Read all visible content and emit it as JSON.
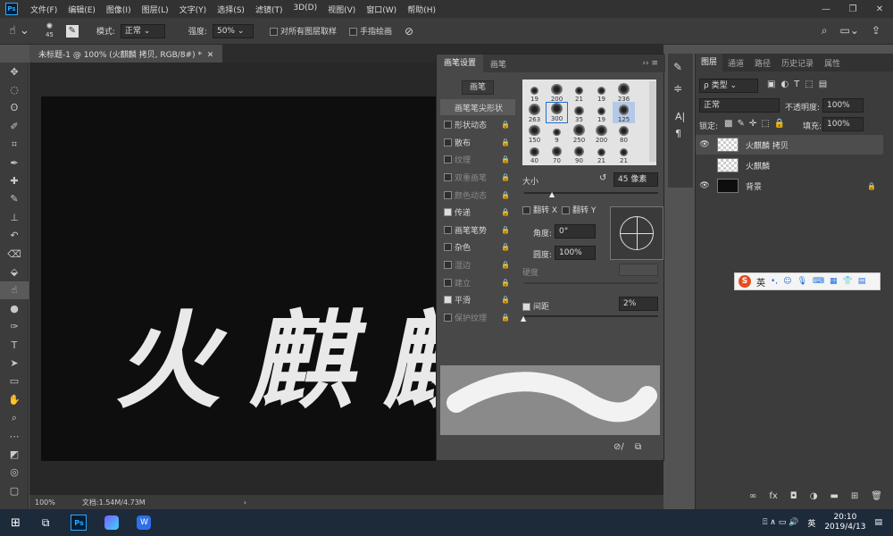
{
  "app": {
    "logo": "Ps",
    "window_controls": [
      "—",
      "❐",
      "✕"
    ]
  },
  "menu": [
    "文件(F)",
    "编辑(E)",
    "图像(I)",
    "图层(L)",
    "文字(Y)",
    "选择(S)",
    "滤镜(T)",
    "3D(D)",
    "视图(V)",
    "窗口(W)",
    "帮助(H)"
  ],
  "options": {
    "brush_size": "45",
    "mode_label": "模式:",
    "mode_value": "正常",
    "strength_label": "强度:",
    "strength_value": "50%",
    "sample_all_label": "对所有图层取样",
    "finger_paint_label": "手指绘画"
  },
  "document": {
    "tab": "未标题-1 @ 100% (火麒麟 拷贝, RGB/8#) *",
    "zoom": "100%",
    "doc_info": "文档:1.54M/4.73M",
    "canvas_text": "火麒麟"
  },
  "brush_panel": {
    "tabs": [
      "画笔设置",
      "画笔"
    ],
    "brushes_button": "画笔",
    "options": [
      {
        "label": "画笔笔尖形状",
        "checked": null,
        "dim": false,
        "lock": false
      },
      {
        "label": "形状动态",
        "checked": false,
        "dim": false,
        "lock": true
      },
      {
        "label": "散布",
        "checked": false,
        "dim": false,
        "lock": true
      },
      {
        "label": "纹理",
        "checked": false,
        "dim": true,
        "lock": true
      },
      {
        "label": "双重画笔",
        "checked": false,
        "dim": true,
        "lock": true
      },
      {
        "label": "颜色动态",
        "checked": false,
        "dim": true,
        "lock": true
      },
      {
        "label": "传递",
        "checked": true,
        "dim": false,
        "lock": true
      },
      {
        "label": "画笔笔势",
        "checked": false,
        "dim": false,
        "lock": true
      },
      {
        "label": "杂色",
        "checked": false,
        "dim": false,
        "lock": true
      },
      {
        "label": "湿边",
        "checked": false,
        "dim": true,
        "lock": true
      },
      {
        "label": "建立",
        "checked": false,
        "dim": true,
        "lock": true
      },
      {
        "label": "平滑",
        "checked": true,
        "dim": false,
        "lock": true
      },
      {
        "label": "保护纹理",
        "checked": false,
        "dim": true,
        "lock": true
      }
    ],
    "tip_sizes": [
      "19",
      "200",
      "21",
      "19",
      "236",
      "263",
      "300",
      "35",
      "19",
      "125",
      "150",
      "9",
      "250",
      "200",
      "80",
      "40",
      "70",
      "90",
      "21",
      "21"
    ],
    "size_label": "大小",
    "size_value": "45 像素",
    "flip_x": "翻转 X",
    "flip_y": "翻转 Y",
    "angle_label": "角度:",
    "angle_value": "0°",
    "roundness_label": "圆度:",
    "roundness_value": "100%",
    "hardness_label": "硬度",
    "spacing_label": "间距",
    "spacing_value": "2%"
  },
  "layers_panel": {
    "tabs": [
      "图层",
      "通道",
      "路径",
      "历史记录",
      "属性"
    ],
    "filter_kind": "ρ 类型",
    "blend_mode": "正常",
    "opacity_label": "不透明度:",
    "opacity_value": "100%",
    "lock_label": "锁定:",
    "fill_label": "填充:",
    "fill_value": "100%",
    "layers": [
      {
        "name": "火麒麟 拷贝",
        "visible": true,
        "selected": true
      },
      {
        "name": "火麒麟",
        "visible": false,
        "selected": false
      },
      {
        "name": "背景",
        "visible": true,
        "selected": false
      }
    ]
  },
  "ime": {
    "logo": "S",
    "lang": "英"
  },
  "taskbar": {
    "time": "20:10",
    "date": "2019/4/13",
    "lang": "英"
  },
  "colors": {
    "accent": "#31a8ff",
    "canvas_bg": "#0e0e0e",
    "panel": "#484848"
  }
}
